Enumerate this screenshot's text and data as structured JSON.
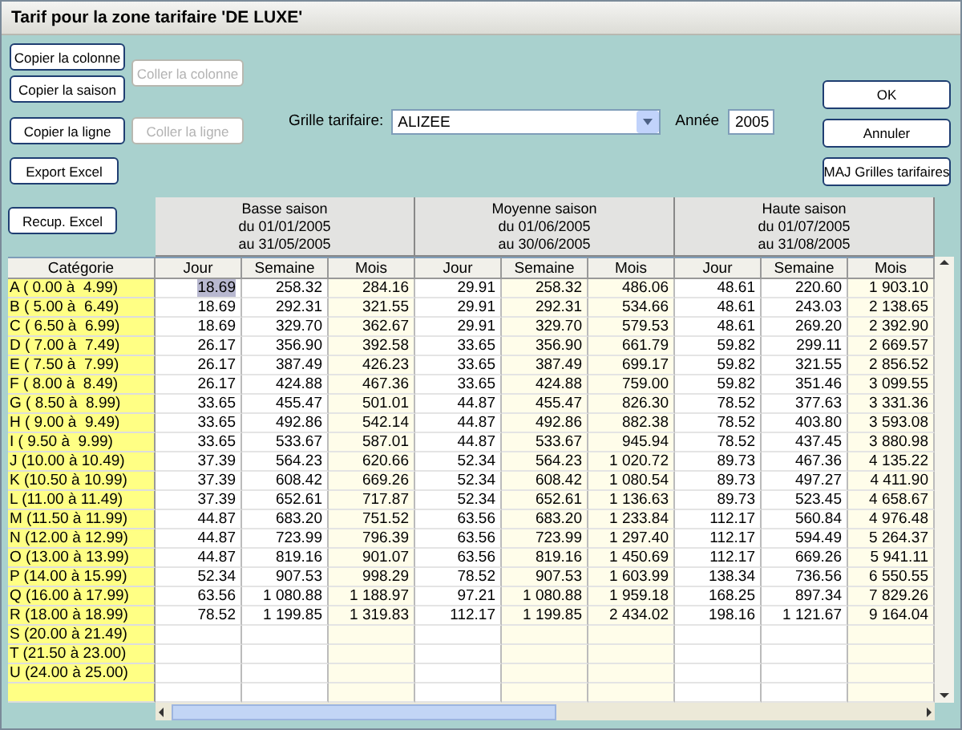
{
  "window": {
    "title": "Tarif pour la zone tarifaire 'DE LUXE'"
  },
  "left_buttons": {
    "copy_column": {
      "label": "Copier la colonne",
      "disabled": false
    },
    "copy_season": {
      "label": "Copier la saison",
      "disabled": false
    },
    "paste_column": {
      "label": "Coller la colonne",
      "disabled": true
    },
    "copy_row": {
      "label": "Copier la ligne",
      "disabled": false
    },
    "paste_row": {
      "label": "Coller la ligne",
      "disabled": true
    },
    "export_excel": {
      "label": "Export Excel",
      "disabled": false
    },
    "recup_excel": {
      "label": "Recup. Excel",
      "disabled": false
    }
  },
  "grid_selector": {
    "label": "Grille tarifaire:",
    "value": "ALIZEE"
  },
  "year": {
    "label": "Année",
    "value": "2005"
  },
  "right_buttons": [
    {
      "label": "OK",
      "disabled": false
    },
    {
      "label": "Annuler",
      "disabled": false
    },
    {
      "label": "MAJ Grilles tarifaires",
      "disabled": false
    }
  ],
  "table": {
    "category_header": "Catégorie",
    "seasons": [
      {
        "name": "Basse saison",
        "from": "du 01/01/2005",
        "to": "au 31/05/2005",
        "columns": [
          {
            "label": "Jour",
            "shaded": false
          },
          {
            "label": "Semaine",
            "shaded": false
          },
          {
            "label": "Mois",
            "shaded": true
          }
        ]
      },
      {
        "name": "Moyenne saison",
        "from": "du 01/06/2005",
        "to": "au 30/06/2005",
        "columns": [
          {
            "label": "Jour",
            "shaded": false
          },
          {
            "label": "Semaine",
            "shaded": true
          },
          {
            "label": "Mois",
            "shaded": true
          }
        ]
      },
      {
        "name": "Haute saison",
        "from": "du 01/07/2005",
        "to": "au 31/08/2005",
        "columns": [
          {
            "label": "Jour",
            "shaded": false
          },
          {
            "label": "Semaine",
            "shaded": false
          },
          {
            "label": "Mois",
            "shaded": true
          }
        ]
      }
    ],
    "rows": [
      {
        "category": "A ( 0.00 à  4.99)",
        "cells": [
          {
            "text": "18.69",
            "selected": true
          },
          {
            "text": "258.32",
            "selected": false
          },
          {
            "text": "284.16",
            "selected": false
          },
          {
            "text": "29.91",
            "selected": false
          },
          {
            "text": "258.32",
            "selected": false
          },
          {
            "text": "486.06",
            "selected": false
          },
          {
            "text": "48.61",
            "selected": false
          },
          {
            "text": "220.60",
            "selected": false
          },
          {
            "text": "1 903.10",
            "selected": false
          }
        ]
      },
      {
        "category": "B ( 5.00 à  6.49)",
        "cells": [
          {
            "text": "18.69",
            "selected": false
          },
          {
            "text": "292.31",
            "selected": false
          },
          {
            "text": "321.55",
            "selected": false
          },
          {
            "text": "29.91",
            "selected": false
          },
          {
            "text": "292.31",
            "selected": false
          },
          {
            "text": "534.66",
            "selected": false
          },
          {
            "text": "48.61",
            "selected": false
          },
          {
            "text": "243.03",
            "selected": false
          },
          {
            "text": "2 138.65",
            "selected": false
          }
        ]
      },
      {
        "category": "C ( 6.50 à  6.99)",
        "cells": [
          {
            "text": "18.69",
            "selected": false
          },
          {
            "text": "329.70",
            "selected": false
          },
          {
            "text": "362.67",
            "selected": false
          },
          {
            "text": "29.91",
            "selected": false
          },
          {
            "text": "329.70",
            "selected": false
          },
          {
            "text": "579.53",
            "selected": false
          },
          {
            "text": "48.61",
            "selected": false
          },
          {
            "text": "269.20",
            "selected": false
          },
          {
            "text": "2 392.90",
            "selected": false
          }
        ]
      },
      {
        "category": "D ( 7.00 à  7.49)",
        "cells": [
          {
            "text": "26.17",
            "selected": false
          },
          {
            "text": "356.90",
            "selected": false
          },
          {
            "text": "392.58",
            "selected": false
          },
          {
            "text": "33.65",
            "selected": false
          },
          {
            "text": "356.90",
            "selected": false
          },
          {
            "text": "661.79",
            "selected": false
          },
          {
            "text": "59.82",
            "selected": false
          },
          {
            "text": "299.11",
            "selected": false
          },
          {
            "text": "2 669.57",
            "selected": false
          }
        ]
      },
      {
        "category": "E ( 7.50 à  7.99)",
        "cells": [
          {
            "text": "26.17",
            "selected": false
          },
          {
            "text": "387.49",
            "selected": false
          },
          {
            "text": "426.23",
            "selected": false
          },
          {
            "text": "33.65",
            "selected": false
          },
          {
            "text": "387.49",
            "selected": false
          },
          {
            "text": "699.17",
            "selected": false
          },
          {
            "text": "59.82",
            "selected": false
          },
          {
            "text": "321.55",
            "selected": false
          },
          {
            "text": "2 856.52",
            "selected": false
          }
        ]
      },
      {
        "category": "F ( 8.00 à  8.49)",
        "cells": [
          {
            "text": "26.17",
            "selected": false
          },
          {
            "text": "424.88",
            "selected": false
          },
          {
            "text": "467.36",
            "selected": false
          },
          {
            "text": "33.65",
            "selected": false
          },
          {
            "text": "424.88",
            "selected": false
          },
          {
            "text": "759.00",
            "selected": false
          },
          {
            "text": "59.82",
            "selected": false
          },
          {
            "text": "351.46",
            "selected": false
          },
          {
            "text": "3 099.55",
            "selected": false
          }
        ]
      },
      {
        "category": "G ( 8.50 à  8.99)",
        "cells": [
          {
            "text": "33.65",
            "selected": false
          },
          {
            "text": "455.47",
            "selected": false
          },
          {
            "text": "501.01",
            "selected": false
          },
          {
            "text": "44.87",
            "selected": false
          },
          {
            "text": "455.47",
            "selected": false
          },
          {
            "text": "826.30",
            "selected": false
          },
          {
            "text": "78.52",
            "selected": false
          },
          {
            "text": "377.63",
            "selected": false
          },
          {
            "text": "3 331.36",
            "selected": false
          }
        ]
      },
      {
        "category": "H ( 9.00 à  9.49)",
        "cells": [
          {
            "text": "33.65",
            "selected": false
          },
          {
            "text": "492.86",
            "selected": false
          },
          {
            "text": "542.14",
            "selected": false
          },
          {
            "text": "44.87",
            "selected": false
          },
          {
            "text": "492.86",
            "selected": false
          },
          {
            "text": "882.38",
            "selected": false
          },
          {
            "text": "78.52",
            "selected": false
          },
          {
            "text": "403.80",
            "selected": false
          },
          {
            "text": "3 593.08",
            "selected": false
          }
        ]
      },
      {
        "category": "I ( 9.50 à  9.99)",
        "cells": [
          {
            "text": "33.65",
            "selected": false
          },
          {
            "text": "533.67",
            "selected": false
          },
          {
            "text": "587.01",
            "selected": false
          },
          {
            "text": "44.87",
            "selected": false
          },
          {
            "text": "533.67",
            "selected": false
          },
          {
            "text": "945.94",
            "selected": false
          },
          {
            "text": "78.52",
            "selected": false
          },
          {
            "text": "437.45",
            "selected": false
          },
          {
            "text": "3 880.98",
            "selected": false
          }
        ]
      },
      {
        "category": "J (10.00 à 10.49)",
        "cells": [
          {
            "text": "37.39",
            "selected": false
          },
          {
            "text": "564.23",
            "selected": false
          },
          {
            "text": "620.66",
            "selected": false
          },
          {
            "text": "52.34",
            "selected": false
          },
          {
            "text": "564.23",
            "selected": false
          },
          {
            "text": "1 020.72",
            "selected": false
          },
          {
            "text": "89.73",
            "selected": false
          },
          {
            "text": "467.36",
            "selected": false
          },
          {
            "text": "4 135.22",
            "selected": false
          }
        ]
      },
      {
        "category": "K (10.50 à 10.99)",
        "cells": [
          {
            "text": "37.39",
            "selected": false
          },
          {
            "text": "608.42",
            "selected": false
          },
          {
            "text": "669.26",
            "selected": false
          },
          {
            "text": "52.34",
            "selected": false
          },
          {
            "text": "608.42",
            "selected": false
          },
          {
            "text": "1 080.54",
            "selected": false
          },
          {
            "text": "89.73",
            "selected": false
          },
          {
            "text": "497.27",
            "selected": false
          },
          {
            "text": "4 411.90",
            "selected": false
          }
        ]
      },
      {
        "category": "L (11.00 à 11.49)",
        "cells": [
          {
            "text": "37.39",
            "selected": false
          },
          {
            "text": "652.61",
            "selected": false
          },
          {
            "text": "717.87",
            "selected": false
          },
          {
            "text": "52.34",
            "selected": false
          },
          {
            "text": "652.61",
            "selected": false
          },
          {
            "text": "1 136.63",
            "selected": false
          },
          {
            "text": "89.73",
            "selected": false
          },
          {
            "text": "523.45",
            "selected": false
          },
          {
            "text": "4 658.67",
            "selected": false
          }
        ]
      },
      {
        "category": "M (11.50 à 11.99)",
        "cells": [
          {
            "text": "44.87",
            "selected": false
          },
          {
            "text": "683.20",
            "selected": false
          },
          {
            "text": "751.52",
            "selected": false
          },
          {
            "text": "63.56",
            "selected": false
          },
          {
            "text": "683.20",
            "selected": false
          },
          {
            "text": "1 233.84",
            "selected": false
          },
          {
            "text": "112.17",
            "selected": false
          },
          {
            "text": "560.84",
            "selected": false
          },
          {
            "text": "4 976.48",
            "selected": false
          }
        ]
      },
      {
        "category": "N (12.00 à 12.99)",
        "cells": [
          {
            "text": "44.87",
            "selected": false
          },
          {
            "text": "723.99",
            "selected": false
          },
          {
            "text": "796.39",
            "selected": false
          },
          {
            "text": "63.56",
            "selected": false
          },
          {
            "text": "723.99",
            "selected": false
          },
          {
            "text": "1 297.40",
            "selected": false
          },
          {
            "text": "112.17",
            "selected": false
          },
          {
            "text": "594.49",
            "selected": false
          },
          {
            "text": "5 264.37",
            "selected": false
          }
        ]
      },
      {
        "category": "O (13.00 à 13.99)",
        "cells": [
          {
            "text": "44.87",
            "selected": false
          },
          {
            "text": "819.16",
            "selected": false
          },
          {
            "text": "901.07",
            "selected": false
          },
          {
            "text": "63.56",
            "selected": false
          },
          {
            "text": "819.16",
            "selected": false
          },
          {
            "text": "1 450.69",
            "selected": false
          },
          {
            "text": "112.17",
            "selected": false
          },
          {
            "text": "669.26",
            "selected": false
          },
          {
            "text": "5 941.11",
            "selected": false
          }
        ]
      },
      {
        "category": "P (14.00 à 15.99)",
        "cells": [
          {
            "text": "52.34",
            "selected": false
          },
          {
            "text": "907.53",
            "selected": false
          },
          {
            "text": "998.29",
            "selected": false
          },
          {
            "text": "78.52",
            "selected": false
          },
          {
            "text": "907.53",
            "selected": false
          },
          {
            "text": "1 603.99",
            "selected": false
          },
          {
            "text": "138.34",
            "selected": false
          },
          {
            "text": "736.56",
            "selected": false
          },
          {
            "text": "6 550.55",
            "selected": false
          }
        ]
      },
      {
        "category": "Q (16.00 à 17.99)",
        "cells": [
          {
            "text": "63.56",
            "selected": false
          },
          {
            "text": "1 080.88",
            "selected": false
          },
          {
            "text": "1 188.97",
            "selected": false
          },
          {
            "text": "97.21",
            "selected": false
          },
          {
            "text": "1 080.88",
            "selected": false
          },
          {
            "text": "1 959.18",
            "selected": false
          },
          {
            "text": "168.25",
            "selected": false
          },
          {
            "text": "897.34",
            "selected": false
          },
          {
            "text": "7 829.26",
            "selected": false
          }
        ]
      },
      {
        "category": "R (18.00 à 18.99)",
        "cells": [
          {
            "text": "78.52",
            "selected": false
          },
          {
            "text": "1 199.85",
            "selected": false
          },
          {
            "text": "1 319.83",
            "selected": false
          },
          {
            "text": "112.17",
            "selected": false
          },
          {
            "text": "1 199.85",
            "selected": false
          },
          {
            "text": "2 434.02",
            "selected": false
          },
          {
            "text": "198.16",
            "selected": false
          },
          {
            "text": "1 121.67",
            "selected": false
          },
          {
            "text": "9 164.04",
            "selected": false
          }
        ]
      },
      {
        "category": "S (20.00 à 21.49)"
      },
      {
        "category": "T (21.50 à 23.00)"
      },
      {
        "category": "U (24.00 à 25.00)"
      }
    ]
  }
}
